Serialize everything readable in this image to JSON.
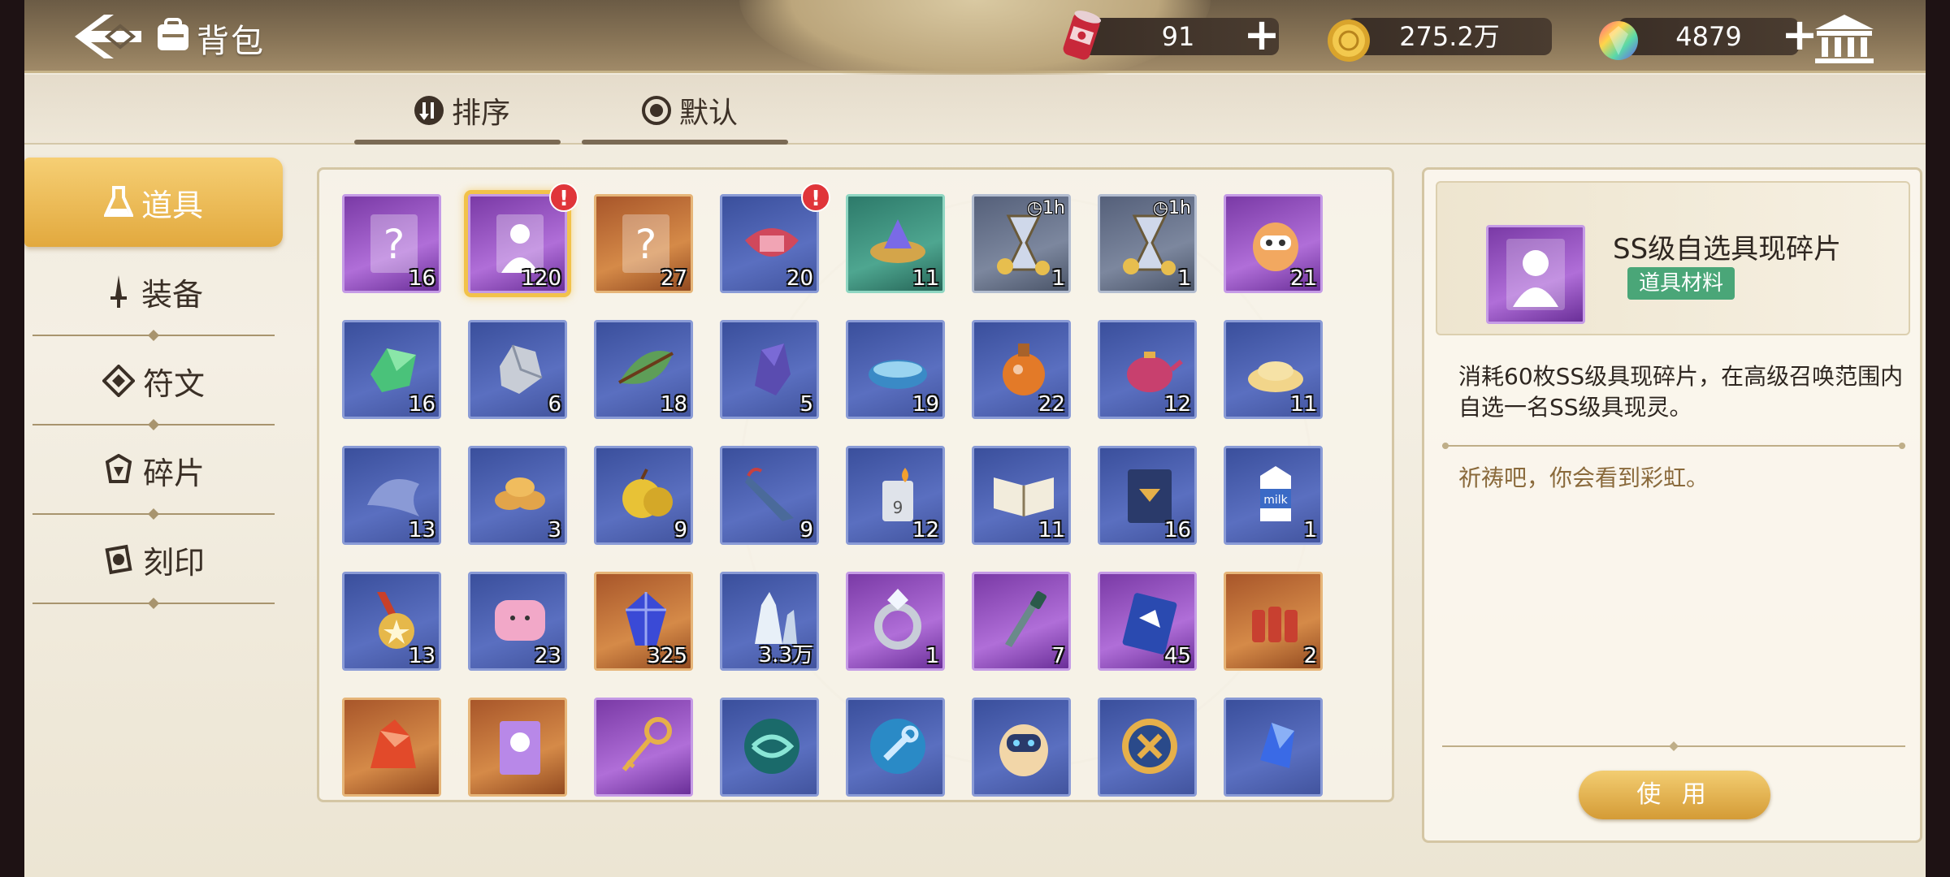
{
  "header": {
    "title": "背包",
    "resources": [
      {
        "name": "stamina",
        "value": "91",
        "icon": "red-can-icon"
      },
      {
        "name": "gold",
        "value": "275.2万",
        "icon": "gold-coin-icon"
      },
      {
        "name": "gem",
        "value": "4879",
        "icon": "rainbow-gem-icon"
      }
    ],
    "plus_label": "+"
  },
  "sort_tabs": {
    "sort_label": "排序",
    "default_label": "默认"
  },
  "categories": [
    {
      "label": "道具",
      "active": true,
      "icon": "flask-icon"
    },
    {
      "label": "装备",
      "active": false,
      "icon": "sword-icon"
    },
    {
      "label": "符文",
      "active": false,
      "icon": "rune-icon"
    },
    {
      "label": "碎片",
      "active": false,
      "icon": "shard-icon"
    },
    {
      "label": "刻印",
      "active": false,
      "icon": "seal-icon"
    }
  ],
  "items": [
    {
      "name": "ss-random-card",
      "count": "16",
      "rarity": "purple",
      "icon": "question-card-icon"
    },
    {
      "name": "ss-select-shard",
      "count": "120",
      "rarity": "purple",
      "icon": "silhouette-card-icon",
      "selected": true,
      "alert": "!"
    },
    {
      "name": "s-random-card",
      "count": "27",
      "rarity": "orange",
      "icon": "question-card-icon"
    },
    {
      "name": "gift-box",
      "count": "20",
      "rarity": "blue",
      "icon": "gift-box-icon",
      "alert": "!"
    },
    {
      "name": "crystal-bowl",
      "count": "11",
      "rarity": "teal",
      "icon": "crystal-bowl-icon"
    },
    {
      "name": "gold-hourglass",
      "count": "1",
      "rarity": "gray",
      "icon": "hourglass-icon",
      "timer": "1h"
    },
    {
      "name": "silver-hourglass",
      "count": "1",
      "rarity": "gray",
      "icon": "hourglass-icon",
      "timer": "1h"
    },
    {
      "name": "robot-egg",
      "count": "21",
      "rarity": "purple",
      "icon": "robot-egg-icon"
    },
    {
      "name": "green-crystal",
      "count": "16",
      "rarity": "blue",
      "icon": "green-crystal-icon"
    },
    {
      "name": "silver-ore",
      "count": "6",
      "rarity": "blue",
      "icon": "silver-ore-icon"
    },
    {
      "name": "leaf-branch",
      "count": "18",
      "rarity": "blue",
      "icon": "leaf-icon"
    },
    {
      "name": "purple-ore",
      "count": "5",
      "rarity": "blue",
      "icon": "purple-ore-icon"
    },
    {
      "name": "water-bowl",
      "count": "19",
      "rarity": "blue",
      "icon": "water-bowl-icon"
    },
    {
      "name": "orange-potion",
      "count": "22",
      "rarity": "blue",
      "icon": "potion-icon"
    },
    {
      "name": "pink-teapot",
      "count": "12",
      "rarity": "blue",
      "icon": "teapot-icon"
    },
    {
      "name": "grain-pile",
      "count": "11",
      "rarity": "blue",
      "icon": "grain-icon"
    },
    {
      "name": "blue-cloth",
      "count": "13",
      "rarity": "blue",
      "icon": "cloth-icon"
    },
    {
      "name": "cookies",
      "count": "3",
      "rarity": "blue",
      "icon": "cookie-icon"
    },
    {
      "name": "golden-apple",
      "count": "9",
      "rarity": "blue",
      "icon": "apple-icon"
    },
    {
      "name": "umbrella",
      "count": "9",
      "rarity": "blue",
      "icon": "umbrella-icon"
    },
    {
      "name": "lighter",
      "count": "12",
      "rarity": "blue",
      "icon": "lighter-icon"
    },
    {
      "name": "open-book",
      "count": "11",
      "rarity": "blue",
      "icon": "book-icon"
    },
    {
      "name": "blue-tome",
      "count": "16",
      "rarity": "blue",
      "icon": "tome-icon"
    },
    {
      "name": "milk-carton",
      "count": "1",
      "rarity": "blue",
      "icon": "milk-icon"
    },
    {
      "name": "gold-medal",
      "count": "13",
      "rarity": "blue",
      "icon": "medal-icon"
    },
    {
      "name": "pink-pillow",
      "count": "23",
      "rarity": "blue",
      "icon": "pillow-icon"
    },
    {
      "name": "blue-gem",
      "count": "325",
      "rarity": "orange",
      "icon": "blue-gem-icon"
    },
    {
      "name": "white-crystal",
      "count": "3.3万",
      "rarity": "blue",
      "icon": "white-crystal-icon"
    },
    {
      "name": "diamond-ring",
      "count": "1",
      "rarity": "purple",
      "icon": "ring-icon"
    },
    {
      "name": "dagger",
      "count": "7",
      "rarity": "purple",
      "icon": "dagger-icon"
    },
    {
      "name": "fashion-tag",
      "count": "45",
      "rarity": "purple",
      "icon": "tag-icon"
    },
    {
      "name": "dynamite",
      "count": "2",
      "rarity": "orange",
      "icon": "dynamite-icon"
    },
    {
      "name": "red-crystal",
      "count": "",
      "rarity": "orange",
      "icon": "red-crystal-icon"
    },
    {
      "name": "ticket-card",
      "count": "",
      "rarity": "orange",
      "icon": "ticket-icon"
    },
    {
      "name": "golden-key",
      "count": "",
      "rarity": "purple",
      "icon": "key-icon"
    },
    {
      "name": "swirl-token",
      "count": "",
      "rarity": "blue",
      "icon": "swirl-icon"
    },
    {
      "name": "wrench-token",
      "count": "",
      "rarity": "blue",
      "icon": "wrench-icon"
    },
    {
      "name": "robot-pod",
      "count": "",
      "rarity": "blue",
      "icon": "robot-pod-icon"
    },
    {
      "name": "cross-coin",
      "count": "",
      "rarity": "blue",
      "icon": "cross-coin-icon"
    },
    {
      "name": "blue-shard",
      "count": "",
      "rarity": "blue",
      "icon": "blue-shard-icon"
    }
  ],
  "detail": {
    "name": "SS级自选具现碎片",
    "tag": "道具材料",
    "description": "消耗60枚SS级具现碎片，在高级召唤范围内自选一名SS级具现灵。",
    "flavor": "祈祷吧，你会看到彩虹。",
    "use_label": "使 用"
  },
  "colors": {
    "accent_gold": "#e2a93e",
    "tag_green": "#4aa678",
    "alert_red": "#e0353a"
  }
}
